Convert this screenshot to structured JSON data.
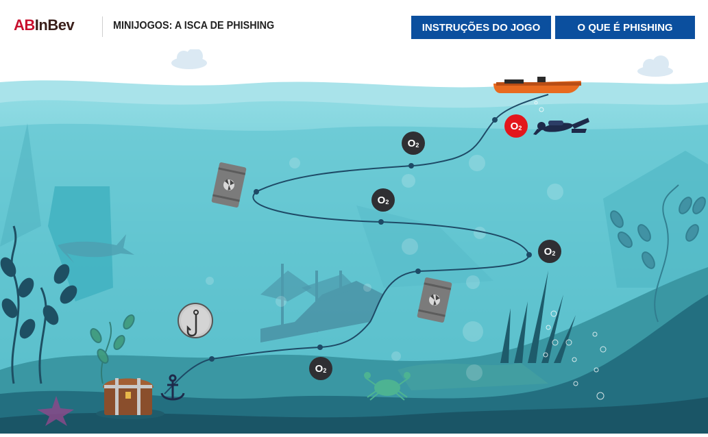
{
  "header": {
    "logo_ab": "AB",
    "logo_inbev": "InBev",
    "title": "MINIJOGOS: A ISCA DE PHISHING",
    "buttons": {
      "instructions": "INSTRUÇÕES DO JOGO",
      "what_is_phishing": "O QUE É PHISHING"
    }
  },
  "game": {
    "oxygen_label": "O",
    "oxygen_sub": "2",
    "oxygen_points": [
      {
        "state": "active"
      },
      {
        "state": "default"
      },
      {
        "state": "default"
      },
      {
        "state": "default"
      },
      {
        "state": "default"
      }
    ]
  },
  "colors": {
    "brand_red": "#c8102e",
    "button_blue": "#0b4f9e",
    "oxygen_active": "#e3161c",
    "oxygen_default": "#2f2f33",
    "water": "#6fcfd8",
    "seabed": "#1f6a7a"
  }
}
